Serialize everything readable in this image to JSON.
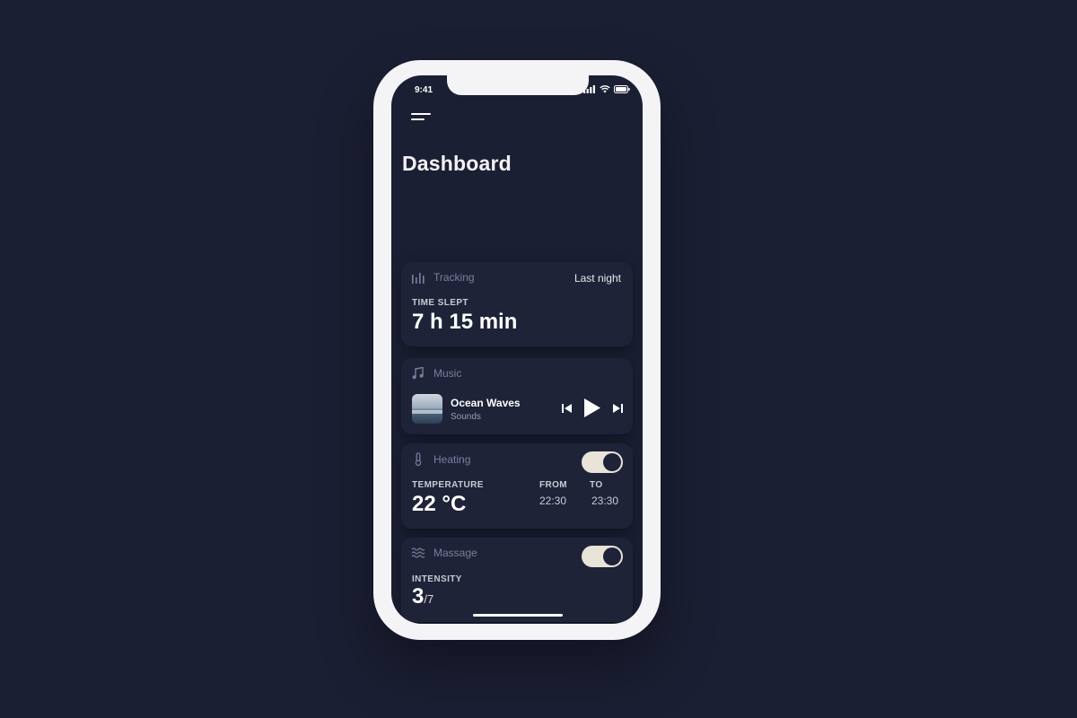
{
  "status": {
    "time": "9:41"
  },
  "header": {
    "title": "Dashboard"
  },
  "tracking": {
    "label": "Tracking",
    "period": "Last night",
    "caption": "TIME SLEPT",
    "value": "7 h 15 min"
  },
  "music": {
    "label": "Music",
    "track": "Ocean Waves",
    "subtitle": "Sounds"
  },
  "heating": {
    "label": "Heating",
    "enabled": true,
    "caption": "TEMPERATURE",
    "value": "22 °C",
    "from_label": "FROM",
    "from_value": "22:30",
    "to_label": "TO",
    "to_value": "23:30"
  },
  "massage": {
    "label": "Massage",
    "enabled": true,
    "caption": "INTENSITY",
    "value": "3",
    "max": "/7"
  },
  "colors": {
    "background": "#1b1f33",
    "card": "#1e2338",
    "toggle_on": "#e9e3d8",
    "muted_label": "#7a809e"
  },
  "icons": {
    "tracking": "bar-chart-icon",
    "music": "music-note-icon",
    "heating": "thermometer-icon",
    "massage": "waves-icon"
  }
}
